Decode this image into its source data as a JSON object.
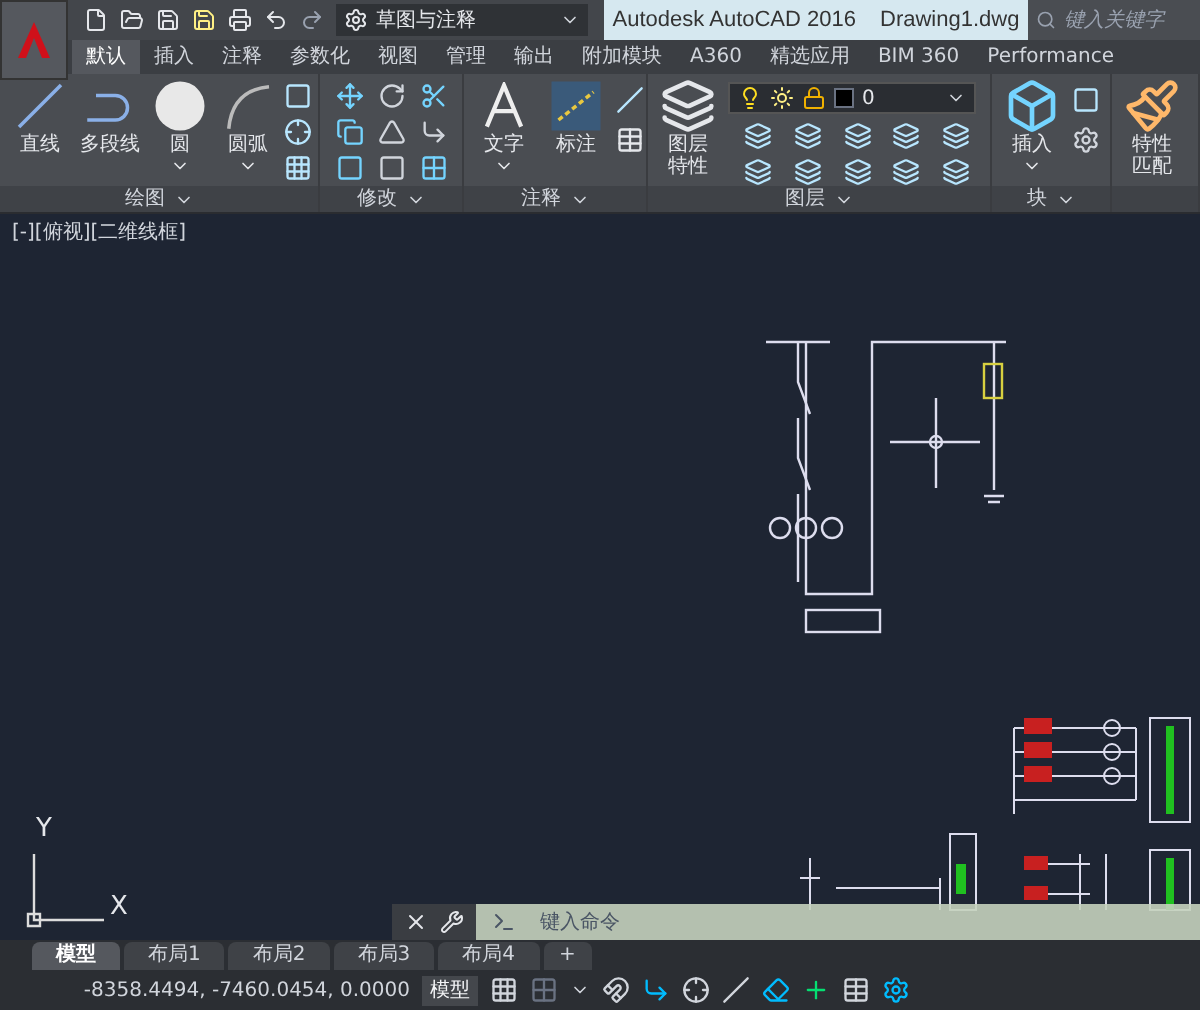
{
  "quick_access": {
    "workspace": "草图与注释"
  },
  "title_bar": {
    "app": "Autodesk AutoCAD 2016",
    "document": "Drawing1.dwg",
    "search": {
      "placeholder": "键入关键字"
    }
  },
  "ribbon_tabs": [
    {
      "label": "默认",
      "selected": true
    },
    {
      "label": "插入",
      "selected": false
    },
    {
      "label": "注释",
      "selected": false
    },
    {
      "label": "参数化",
      "selected": false
    },
    {
      "label": "视图",
      "selected": false
    },
    {
      "label": "管理",
      "selected": false
    },
    {
      "label": "输出",
      "selected": false
    },
    {
      "label": "附加模块",
      "selected": false
    },
    {
      "label": "A360",
      "selected": false
    },
    {
      "label": "精选应用",
      "selected": false
    },
    {
      "label": "BIM 360",
      "selected": false
    },
    {
      "label": "Performance",
      "selected": false
    }
  ],
  "ribbon_panels": [
    {
      "kind": "draw",
      "title": "绘图",
      "tools": [
        {
          "kind": "line",
          "label_lines": [
            "直线"
          ],
          "dropdown": false
        },
        {
          "kind": "polyline",
          "label_lines": [
            "多段线"
          ],
          "dropdown": false
        },
        {
          "kind": "circle",
          "label_lines": [
            "圆"
          ],
          "dropdown": true
        },
        {
          "kind": "arc",
          "label_lines": [
            "圆弧"
          ],
          "dropdown": true
        }
      ]
    },
    {
      "kind": "modify",
      "title": "修改"
    },
    {
      "kind": "annotate",
      "title": "注释",
      "tools": [
        {
          "kind": "text",
          "label_lines": [
            "文字"
          ],
          "dropdown": true
        },
        {
          "kind": "dimension",
          "label_lines": [
            "标注"
          ],
          "dropdown": false
        }
      ]
    },
    {
      "kind": "layers",
      "title": "图层",
      "layer": "0",
      "tools": [
        {
          "kind": "layers",
          "label_lines": [
            "图层",
            "特性"
          ],
          "dropdown": false
        }
      ]
    },
    {
      "kind": "block",
      "title": "块",
      "tools": [
        {
          "kind": "insert",
          "label_lines": [
            "插入"
          ],
          "dropdown": true
        }
      ]
    },
    {
      "kind": "properties",
      "tools": [
        {
          "kind": "match",
          "label_lines": [
            "特性",
            "匹配"
          ],
          "dropdown": false
        }
      ]
    }
  ],
  "viewport": {
    "label": "[-][俯视][二维线框]",
    "ucs": {
      "x": "X",
      "y": "Y"
    }
  },
  "command_line": {
    "placeholder": "键入命令"
  },
  "layout_tabs": [
    {
      "label": "模型",
      "selected": true
    },
    {
      "label": "布局1",
      "selected": false
    },
    {
      "label": "布局2",
      "selected": false
    },
    {
      "label": "布局3",
      "selected": false
    },
    {
      "label": "布局4",
      "selected": false
    }
  ],
  "add_tab": "+",
  "status_bar": {
    "coordinates": "-8358.4494, -7460.0454, 0.0000",
    "space": "模型"
  }
}
